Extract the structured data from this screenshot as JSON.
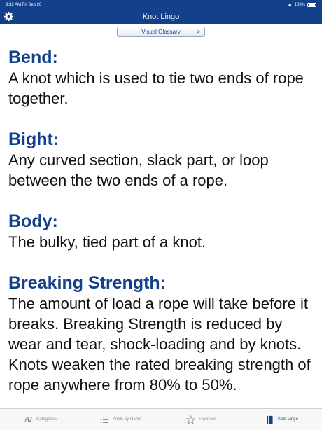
{
  "status": {
    "time": "9:32 AM",
    "date": "Fri Sep 20",
    "battery": "100%"
  },
  "nav": {
    "title": "Knot Lingo"
  },
  "glossary_button": {
    "label": "Visual Glossary",
    "chevron": ">"
  },
  "entries": [
    {
      "term": "Bend:",
      "definition": "A knot which is used to tie two ends of rope together."
    },
    {
      "term": "Bight:",
      "definition": "Any curved section, slack part, or loop between the two ends of a rope."
    },
    {
      "term": "Body:",
      "definition": "The bulky, tied part of a knot."
    },
    {
      "term": "Breaking Strength:",
      "definition": "The amount of load a rope will take before it breaks. Breaking Strength is reduced by wear and tear, shock-loading and by knots. Knots weaken the rated breaking strength of rope anywhere from 80% to 50%."
    }
  ],
  "tabs": [
    {
      "label": "Categories",
      "icon": "knot-icon"
    },
    {
      "label": "Knots by Name",
      "icon": "list-icon"
    },
    {
      "label": "Favorites",
      "icon": "star-icon"
    },
    {
      "label": "Knot Lingo",
      "icon": "book-icon",
      "active": true
    }
  ],
  "colors": {
    "brand": "#12408a",
    "inactive": "#8e8e93"
  }
}
